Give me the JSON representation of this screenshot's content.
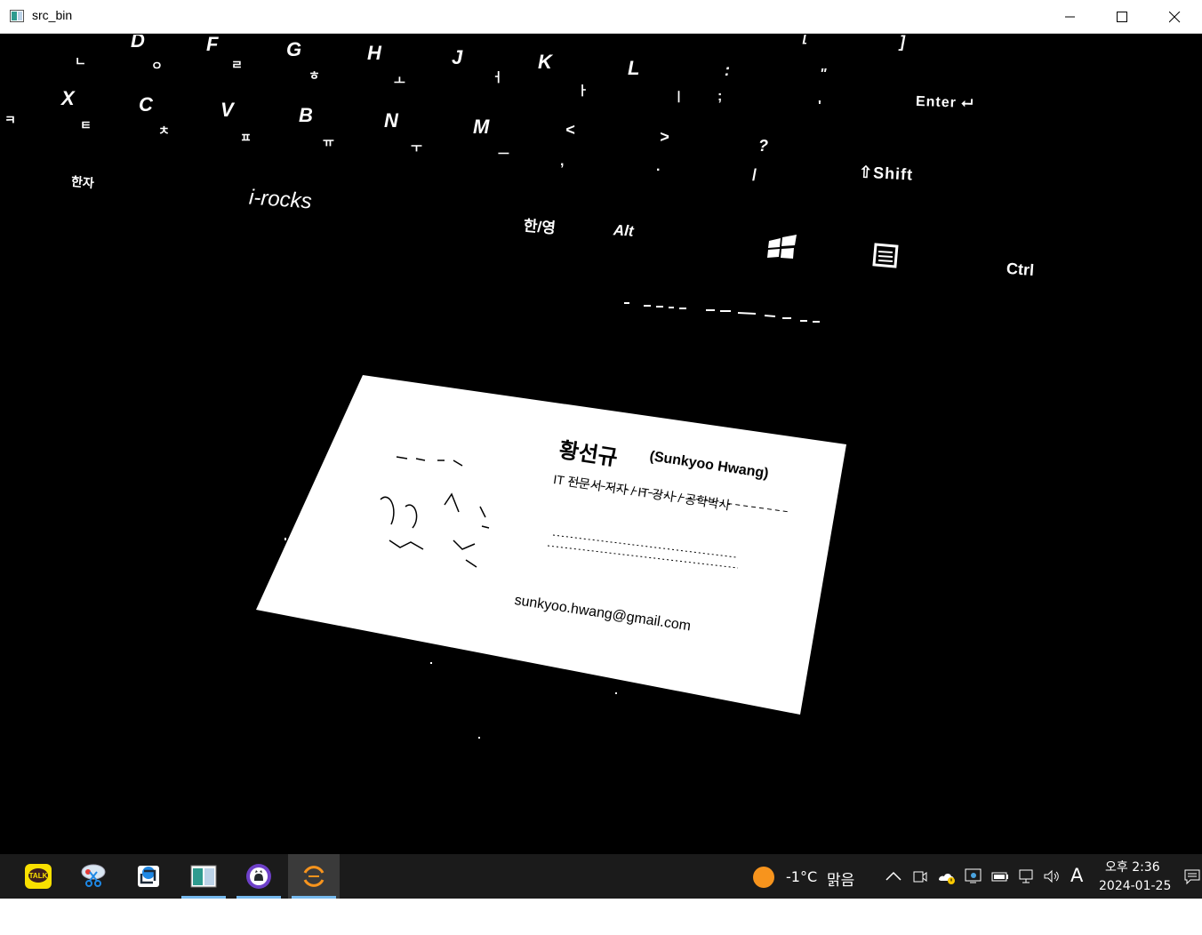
{
  "window": {
    "title": "src_bin",
    "controls": {
      "minimize": "minimize",
      "maximize": "maximize",
      "close": "close"
    }
  },
  "keyboard_keys": {
    "row_top": [
      "D",
      "F",
      "G",
      "H",
      "J",
      "K",
      "L",
      ":",
      "\"",
      "[",
      "]"
    ],
    "row_top_hangul": [
      "ㄴ",
      "ㅇ",
      "ㄹ",
      "ㅎ",
      "ㅗ",
      "ㅓ",
      "ㅏ",
      "ㅣ",
      ";",
      "'"
    ],
    "row_mid": [
      "X",
      "C",
      "V",
      "B",
      "N",
      "M",
      "<",
      ">",
      "?"
    ],
    "row_mid_hangul": [
      "ㅋ",
      "ㅌ",
      "ㅊ",
      "ㅍ",
      "ㅠ",
      "ㅜ",
      "ㅡ",
      ",",
      ".",
      "/"
    ],
    "enter": "Enter",
    "shift": "Shift",
    "hanja": "한자",
    "brand": "i-rocks",
    "han_yeong": "한/영",
    "alt": "Alt",
    "ctrl": "Ctrl"
  },
  "card": {
    "name_korean": "황선규",
    "name_english": "(Sunkyoo Hwang)",
    "role": "IT 전문서 저자 / IT 강사 / 공학박사",
    "email": "sunkyoo.hwang@gmail.com"
  },
  "taskbar": {
    "apps": [
      {
        "name": "KakaoTalk",
        "icon": "kakaotalk-icon",
        "label": "TALK"
      },
      {
        "name": "Snipping tool",
        "icon": "scissors-icon"
      },
      {
        "name": "Screen capture",
        "icon": "capture-icon"
      },
      {
        "name": "OpenCV window",
        "icon": "opencv-window-icon"
      },
      {
        "name": "GitHub Desktop",
        "icon": "github-icon"
      },
      {
        "name": "Eclipse",
        "icon": "eclipse-icon"
      }
    ],
    "weather": {
      "temp": "-1°C",
      "condition": "맑음",
      "icon": "sun-icon"
    },
    "ime": "A",
    "clock": {
      "time": "오후 2:36",
      "date": "2024-01-25"
    }
  },
  "colors": {
    "titlebar": "#ffffff",
    "canvas": "#000000",
    "taskbar": "#1b1b1b",
    "accent": "#76b9ed",
    "kakao": "#f9e000",
    "github": "#6e40c9",
    "sun": "#f7941d"
  }
}
